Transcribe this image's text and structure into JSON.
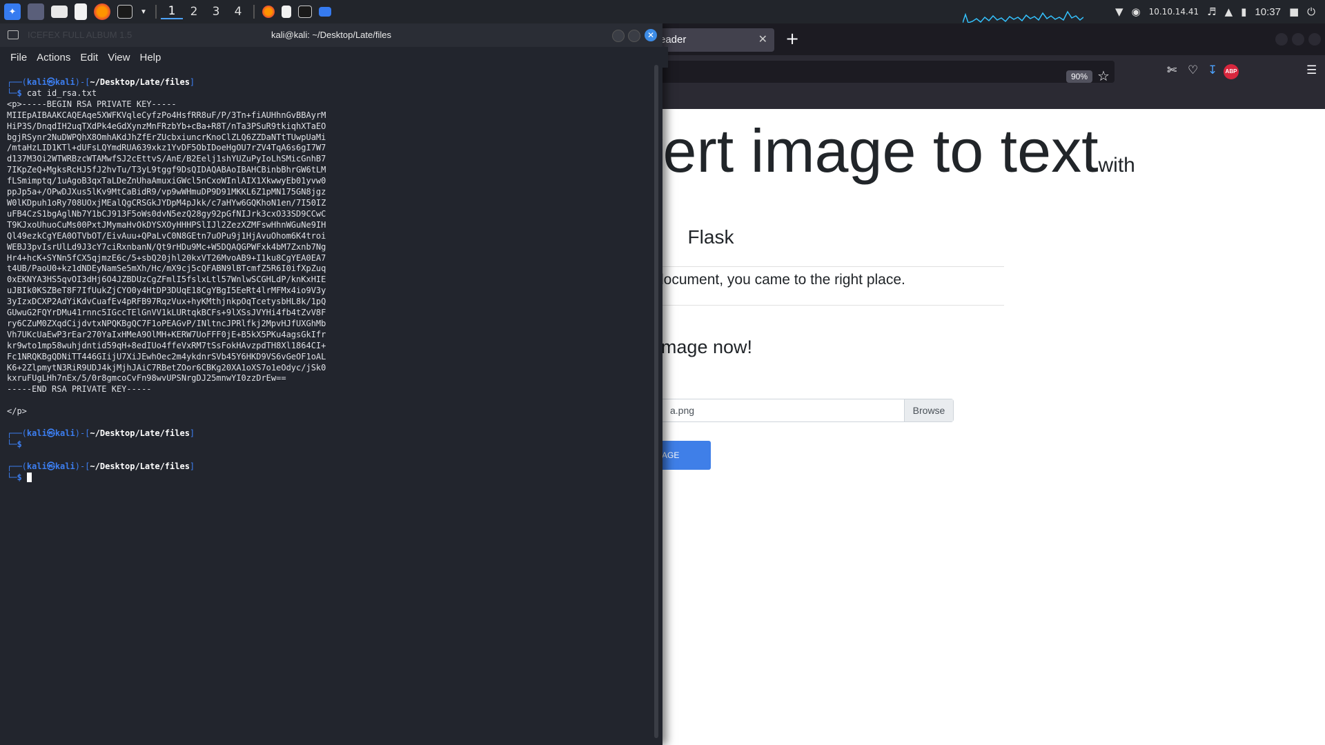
{
  "panel": {
    "workspaces": [
      "1",
      "2",
      "3",
      "4"
    ],
    "ip": "10.10.14.41",
    "clock": "10:37"
  },
  "browser": {
    "tab_title": "eader",
    "zoom": "90%",
    "page": {
      "heading": "Convert image to text",
      "heading_small": "with",
      "subheading": "Flask",
      "lead": "If you want to turn an image into a text document, you came to the right place.",
      "upload_title": "Convert your image now!",
      "file_name": "a.png",
      "browse_label": "Browse",
      "scan_label": "IMAGE"
    }
  },
  "terminal": {
    "title": "kali@kali: ~/Desktop/Late/files",
    "ghost_title": "ICEFEX FULL ALBUM 1.5",
    "menu": [
      "File",
      "Actions",
      "Edit",
      "View",
      "Help"
    ],
    "prompt_user": "kali",
    "prompt_host": "kali",
    "prompt_dir": "~/Desktop/Late/files",
    "command": "cat id_rsa.txt",
    "output": [
      "<p>-----BEGIN RSA PRIVATE KEY-----",
      "MIIEpAIBAAKCAQEAqe5XWFKVqleCyfzPo4HsfRR8uF/P/3Tn+fiAUHhnGvBBAyrM",
      "HiP3S/DnqdIH2uqTXdPk4eGdXynzMnFRzbYb+cBa+R8T/nTa3PSuR9tkiqhXTaEO",
      "bgjRSynr2NuDWPQhX8OmhAKdJhZfErZUcbxiuncrKnoClZLQ6ZZDaNTtTUwpUaMi",
      "/mtaHzLID1KTl+dUFsLQYmdRUA639xkz1YvDF5ObIDoeHgOU7rZV4TqA6s6gI7W7",
      "d137M3Oi2WTWRBzcWTAMwfSJ2cEttvS/AnE/B2Eelj1shYUZuPyIoLhSMicGnhB7",
      "7IKpZeQ+MgksRcHJ5fJ2hvTu/T3yL9tggf9DsQIDAQABAoIBAHCBinbBhrGW6tLM",
      "fLSmimptq/1uAgoB3qxTaLDeZnUhaAmuxiGWcl5nCxoWInlAIX1XkwwyEb01yvw0",
      "ppJp5a+/OPwDJXus5lKv9MtCaBidR9/vp9wWHmuDP9D91MKKL6Z1pMN175GN8jgz",
      "W0lKDpuh1oRy708UOxjMEalQgCRSGkJYDpM4pJkk/c7aHYw6GQKhoN1en/7I50IZ",
      "uFB4CzS1bgAglNb7Y1bCJ913F5oWs0dvN5ezQ28gy92pGfNIJrk3cxO33SD9CCwC",
      "T9KJxoUhuoCuMs00PxtJMymaHvOkDYSXOyHHHPSlIJl2ZezXZMFswHhnWGuNe9IH",
      "Ql49ezkCgYEA0OTVbOT/EivAuu+QPaLvC0N8GEtn7uOPu9j1HjAvuOhom6K4troi",
      "WEBJ3pvIsrUlLd9J3cY7ciRxnbanN/Qt9rHDu9Mc+W5DQAQGPWFxk4bM7Zxnb7Ng",
      "Hr4+hcK+SYNn5fCX5qjmzE6c/5+sbQ20jhl20kxVT26MvoAB9+I1ku8CgYEA0EA7",
      "t4UB/PaoU0+kz1dNDEyNamSe5mXh/Hc/mX9cj5cQFABN9lBTcmfZ5R6I0ifXpZuq",
      "0xEKNYA3HS5qvOI3dHj6O4JZBDUzCgZFmlI5fslxLtl57WnlwSCGHLdP/knKxHIE",
      "uJBIk0KSZBeT8F7IfUukZjCYO0y4HtDP3DUqE18CgYBgI5EeRt4lrMFMx4io9V3y",
      "3yIzxDCXP2AdYiKdvCuafEv4pRFB97RqzVux+hyKMthjnkpOqTcetysbHL8k/1pQ",
      "GUwuG2FQYrDMu41rnnc5IGccTElGnVV1kLURtqkBCFs+9lXSsJVYHi4fb4tZvV8F",
      "ry6CZuM0ZXqdCijdvtxNPQKBgQC7F1oPEAGvP/INltncJPRlfkj2MpvHJfUXGhMb",
      "Vh7UKcUaEwP3rEar270YaIxHMeA9OlMH+KERW7UoFFF0jE+B5kX5PKu4agsGkIfr",
      "kr9wto1mp58wuhjdntid59qH+8edIUo4ffeVxRM7tSsFokHAvzpdTH8Xl1864CI+",
      "Fc1NRQKBgQDNiTT446GIijU7XiJEwhOec2m4ykdnrSVb45Y6HKD9VS6vGeOF1oAL",
      "K6+2ZlpmytN3RiR9UDJ4kjMjhJAiC7RBetZOor6CBKg20XA1oXS7o1eOdyc/jSk0",
      "kxruFUgLHh7nEx/5/0r8gmcoCvFn98wvUPSNrgDJ25mnwYI0zzDrEw==",
      "-----END RSA PRIVATE KEY-----",
      "",
      "</p>"
    ]
  },
  "colors": {
    "terminal_bg": "#22252d",
    "prompt_blue": "#3c7ef0",
    "accent": "#3d8ce6",
    "browser_button": "#3f7fe8"
  }
}
